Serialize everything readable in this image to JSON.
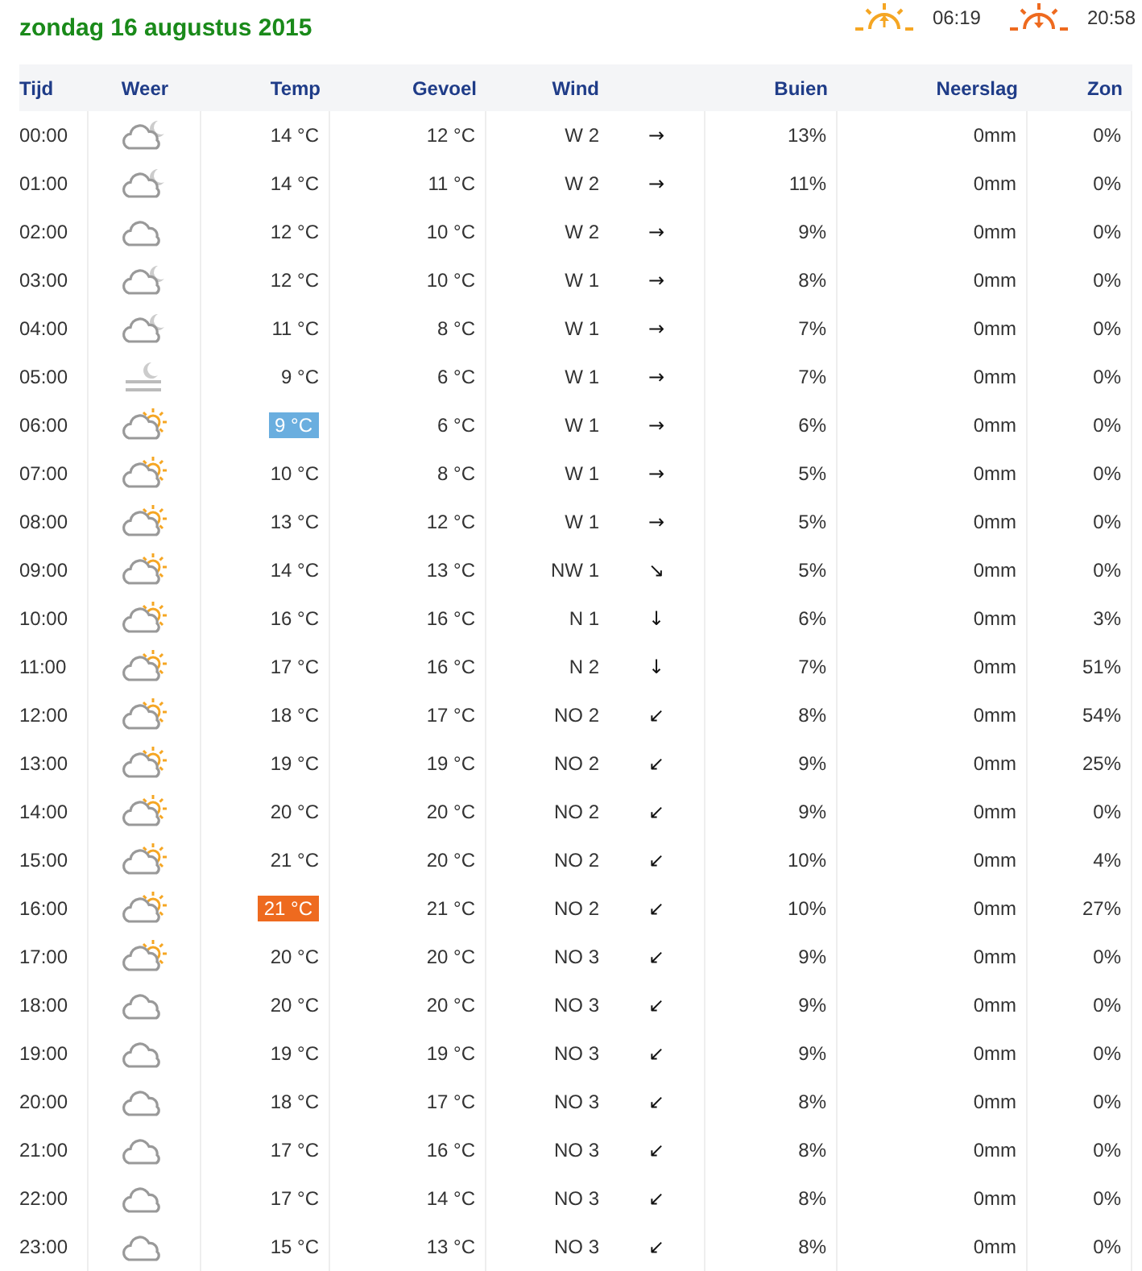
{
  "title": "zondag 16 augustus 2015",
  "sun": {
    "sunrise": "06:19",
    "sunset": "20:58"
  },
  "columns": [
    "Tijd",
    "Weer",
    "Temp",
    "Gevoel",
    "Wind",
    "Buien",
    "Neerslag",
    "Zon"
  ],
  "rows": [
    {
      "time": "00:00",
      "kind": "cloud-moon",
      "temp": "14 °C",
      "coldest": false,
      "warmest": false,
      "feel": "12 °C",
      "wind": "W 2",
      "arrow": "→",
      "rain_chance": "13%",
      "precip": "0mm",
      "sun": "0%"
    },
    {
      "time": "01:00",
      "kind": "cloud-moon",
      "temp": "14 °C",
      "coldest": false,
      "warmest": false,
      "feel": "11 °C",
      "wind": "W 2",
      "arrow": "→",
      "rain_chance": "11%",
      "precip": "0mm",
      "sun": "0%"
    },
    {
      "time": "02:00",
      "kind": "cloud",
      "temp": "12 °C",
      "coldest": false,
      "warmest": false,
      "feel": "10 °C",
      "wind": "W 2",
      "arrow": "→",
      "rain_chance": "9%",
      "precip": "0mm",
      "sun": "0%"
    },
    {
      "time": "03:00",
      "kind": "cloud-moon",
      "temp": "12 °C",
      "coldest": false,
      "warmest": false,
      "feel": "10 °C",
      "wind": "W 1",
      "arrow": "→",
      "rain_chance": "8%",
      "precip": "0mm",
      "sun": "0%"
    },
    {
      "time": "04:00",
      "kind": "cloud-moon",
      "temp": "11 °C",
      "coldest": false,
      "warmest": false,
      "feel": "8 °C",
      "wind": "W 1",
      "arrow": "→",
      "rain_chance": "7%",
      "precip": "0mm",
      "sun": "0%"
    },
    {
      "time": "05:00",
      "kind": "fog-moon",
      "temp": "9 °C",
      "coldest": false,
      "warmest": false,
      "feel": "6 °C",
      "wind": "W 1",
      "arrow": "→",
      "rain_chance": "7%",
      "precip": "0mm",
      "sun": "0%"
    },
    {
      "time": "06:00",
      "kind": "cloud-sun",
      "temp": "9 °C",
      "coldest": true,
      "warmest": false,
      "feel": "6 °C",
      "wind": "W 1",
      "arrow": "→",
      "rain_chance": "6%",
      "precip": "0mm",
      "sun": "0%"
    },
    {
      "time": "07:00",
      "kind": "cloud-sun",
      "temp": "10 °C",
      "coldest": false,
      "warmest": false,
      "feel": "8 °C",
      "wind": "W 1",
      "arrow": "→",
      "rain_chance": "5%",
      "precip": "0mm",
      "sun": "0%"
    },
    {
      "time": "08:00",
      "kind": "cloud-sun",
      "temp": "13 °C",
      "coldest": false,
      "warmest": false,
      "feel": "12 °C",
      "wind": "W 1",
      "arrow": "→",
      "rain_chance": "5%",
      "precip": "0mm",
      "sun": "0%"
    },
    {
      "time": "09:00",
      "kind": "cloud-sun",
      "temp": "14 °C",
      "coldest": false,
      "warmest": false,
      "feel": "13 °C",
      "wind": "NW 1",
      "arrow": "↘",
      "rain_chance": "5%",
      "precip": "0mm",
      "sun": "0%"
    },
    {
      "time": "10:00",
      "kind": "cloud-sun",
      "temp": "16 °C",
      "coldest": false,
      "warmest": false,
      "feel": "16 °C",
      "wind": "N 1",
      "arrow": "↓",
      "rain_chance": "6%",
      "precip": "0mm",
      "sun": "3%"
    },
    {
      "time": "11:00",
      "kind": "cloud-sun",
      "temp": "17 °C",
      "coldest": false,
      "warmest": false,
      "feel": "16 °C",
      "wind": "N 2",
      "arrow": "↓",
      "rain_chance": "7%",
      "precip": "0mm",
      "sun": "51%"
    },
    {
      "time": "12:00",
      "kind": "cloud-sun",
      "temp": "18 °C",
      "coldest": false,
      "warmest": false,
      "feel": "17 °C",
      "wind": "NO 2",
      "arrow": "↙",
      "rain_chance": "8%",
      "precip": "0mm",
      "sun": "54%"
    },
    {
      "time": "13:00",
      "kind": "cloud-sun",
      "temp": "19 °C",
      "coldest": false,
      "warmest": false,
      "feel": "19 °C",
      "wind": "NO 2",
      "arrow": "↙",
      "rain_chance": "9%",
      "precip": "0mm",
      "sun": "25%"
    },
    {
      "time": "14:00",
      "kind": "cloud-sun",
      "temp": "20 °C",
      "coldest": false,
      "warmest": false,
      "feel": "20 °C",
      "wind": "NO 2",
      "arrow": "↙",
      "rain_chance": "9%",
      "precip": "0mm",
      "sun": "0%"
    },
    {
      "time": "15:00",
      "kind": "cloud-sun",
      "temp": "21 °C",
      "coldest": false,
      "warmest": false,
      "feel": "20 °C",
      "wind": "NO 2",
      "arrow": "↙",
      "rain_chance": "10%",
      "precip": "0mm",
      "sun": "4%"
    },
    {
      "time": "16:00",
      "kind": "cloud-sun",
      "temp": "21 °C",
      "coldest": false,
      "warmest": true,
      "feel": "21 °C",
      "wind": "NO 2",
      "arrow": "↙",
      "rain_chance": "10%",
      "precip": "0mm",
      "sun": "27%"
    },
    {
      "time": "17:00",
      "kind": "cloud-sun",
      "temp": "20 °C",
      "coldest": false,
      "warmest": false,
      "feel": "20 °C",
      "wind": "NO 3",
      "arrow": "↙",
      "rain_chance": "9%",
      "precip": "0mm",
      "sun": "0%"
    },
    {
      "time": "18:00",
      "kind": "cloud",
      "temp": "20 °C",
      "coldest": false,
      "warmest": false,
      "feel": "20 °C",
      "wind": "NO 3",
      "arrow": "↙",
      "rain_chance": "9%",
      "precip": "0mm",
      "sun": "0%"
    },
    {
      "time": "19:00",
      "kind": "cloud",
      "temp": "19 °C",
      "coldest": false,
      "warmest": false,
      "feel": "19 °C",
      "wind": "NO 3",
      "arrow": "↙",
      "rain_chance": "9%",
      "precip": "0mm",
      "sun": "0%"
    },
    {
      "time": "20:00",
      "kind": "cloud",
      "temp": "18 °C",
      "coldest": false,
      "warmest": false,
      "feel": "17 °C",
      "wind": "NO 3",
      "arrow": "↙",
      "rain_chance": "8%",
      "precip": "0mm",
      "sun": "0%"
    },
    {
      "time": "21:00",
      "kind": "cloud",
      "temp": "17 °C",
      "coldest": false,
      "warmest": false,
      "feel": "16 °C",
      "wind": "NO 3",
      "arrow": "↙",
      "rain_chance": "8%",
      "precip": "0mm",
      "sun": "0%"
    },
    {
      "time": "22:00",
      "kind": "cloud",
      "temp": "17 °C",
      "coldest": false,
      "warmest": false,
      "feel": "14 °C",
      "wind": "NO 3",
      "arrow": "↙",
      "rain_chance": "8%",
      "precip": "0mm",
      "sun": "0%"
    },
    {
      "time": "23:00",
      "kind": "cloud",
      "temp": "15 °C",
      "coldest": false,
      "warmest": false,
      "feel": "13 °C",
      "wind": "NO 3",
      "arrow": "↙",
      "rain_chance": "8%",
      "precip": "0mm",
      "sun": "0%"
    }
  ]
}
